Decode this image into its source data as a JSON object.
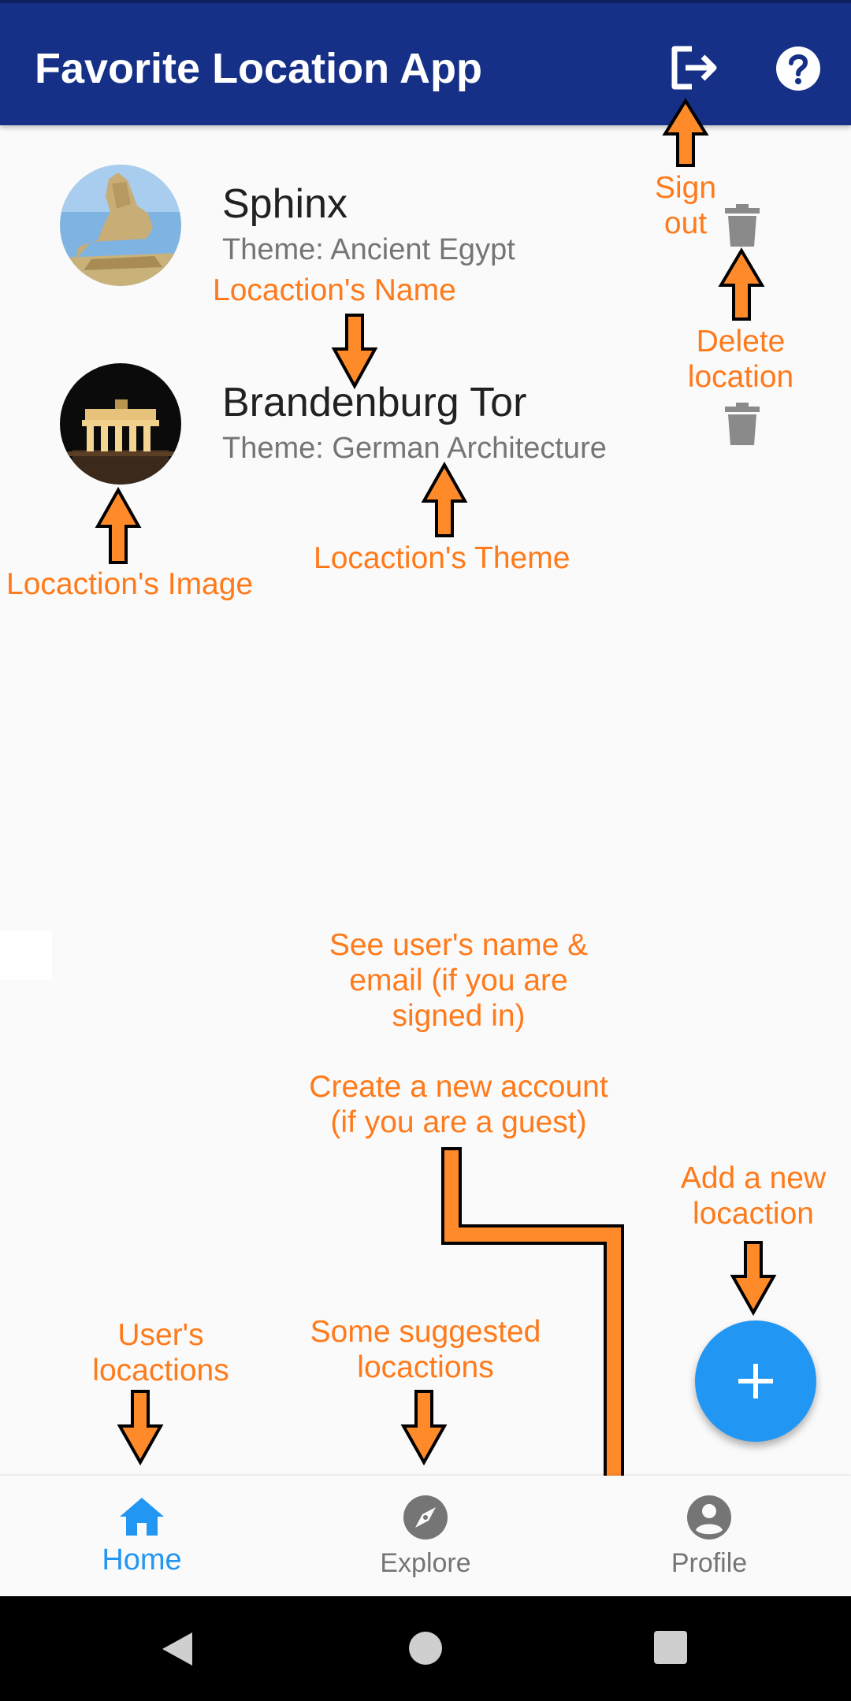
{
  "appbar": {
    "title": "Favorite Location App",
    "signout_icon": "sign-out-icon",
    "help_icon": "help-circle-icon",
    "color": "#153086"
  },
  "locations": [
    {
      "name": "Sphinx",
      "theme": "Theme: Ancient Egypt",
      "image": "sphinx-photo",
      "delete_icon": "trash-icon"
    },
    {
      "name": "Brandenburg Tor",
      "theme": "Theme: German Architecture",
      "image": "brandenburg-gate-photo",
      "delete_icon": "trash-icon"
    }
  ],
  "annotations": {
    "color": "#ff7a1a",
    "sign_out": [
      "Sign",
      "out"
    ],
    "delete_location": [
      "Delete",
      "location"
    ],
    "location_name": "Locaction's Name",
    "location_image": "Locaction's Image",
    "location_theme": "Locaction's Theme",
    "profile_note": [
      "See user's name &",
      "email (if you are",
      "signed in)"
    ],
    "account_note": [
      "Create a new account",
      "(if you are a guest)"
    ],
    "add_note": [
      "Add a new",
      "locaction"
    ],
    "home_note": [
      "User's",
      "locactions"
    ],
    "explore_note": [
      "Some suggested",
      "locactions"
    ]
  },
  "fab": {
    "icon": "plus-icon",
    "color": "#2196f3"
  },
  "bottom_nav": {
    "items": [
      {
        "label": "Home",
        "icon": "home-icon",
        "active": true
      },
      {
        "label": "Explore",
        "icon": "compass-icon",
        "active": false
      },
      {
        "label": "Profile",
        "icon": "account-circle-icon",
        "active": false
      }
    ],
    "active_color": "#2196f3"
  },
  "system_nav": {
    "back_icon": "back-triangle-icon",
    "home_icon": "home-circle-icon",
    "recents_icon": "recents-square-icon"
  }
}
